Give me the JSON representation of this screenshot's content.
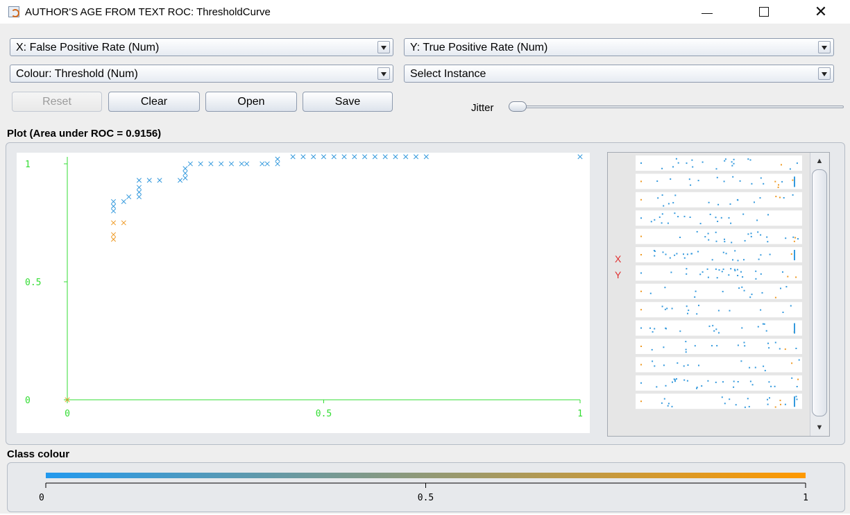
{
  "window": {
    "title": "AUTHOR'S AGE FROM TEXT ROC: ThresholdCurve",
    "controls": {
      "minimize": "—",
      "maximize": "☐",
      "close": "✕"
    }
  },
  "controls": {
    "x_axis_select": "X: False Positive Rate (Num)",
    "y_axis_select": "Y: True Positive Rate (Num)",
    "colour_select": "Colour: Threshold (Num)",
    "instance_select": "Select Instance",
    "buttons": {
      "reset": "Reset",
      "clear": "Clear",
      "open": "Open",
      "save": "Save"
    },
    "jitter_label": "Jitter",
    "jitter_value": 0
  },
  "plot": {
    "title": "Plot (Area under ROC = 0.9156)",
    "axis_color": "#33dd33",
    "marker": "x"
  },
  "chart_data": {
    "type": "scatter",
    "title": "Plot (Area under ROC = 0.9156)",
    "xlabel": "",
    "ylabel": "",
    "xlim": [
      0,
      1
    ],
    "ylim": [
      0,
      1
    ],
    "x_ticks": [
      "0",
      "0.5",
      "1"
    ],
    "y_ticks": [
      "0",
      "0.5",
      "1"
    ],
    "grid": false,
    "series": [
      {
        "color": "#3399dd",
        "points": [
          [
            0.09,
            0.8
          ],
          [
            0.09,
            0.82
          ],
          [
            0.09,
            0.84
          ],
          [
            0.11,
            0.84
          ],
          [
            0.12,
            0.86
          ],
          [
            0.14,
            0.86
          ],
          [
            0.14,
            0.88
          ],
          [
            0.14,
            0.9
          ],
          [
            0.14,
            0.93
          ],
          [
            0.16,
            0.93
          ],
          [
            0.18,
            0.93
          ],
          [
            0.22,
            0.93
          ],
          [
            0.23,
            0.94
          ],
          [
            0.23,
            0.96
          ],
          [
            0.23,
            0.98
          ],
          [
            0.24,
            1.0
          ],
          [
            0.26,
            1.0
          ],
          [
            0.28,
            1.0
          ],
          [
            0.3,
            1.0
          ],
          [
            0.32,
            1.0
          ],
          [
            0.34,
            1.0
          ],
          [
            0.35,
            1.0
          ],
          [
            0.38,
            1.0
          ],
          [
            0.39,
            1.0
          ],
          [
            0.41,
            1.0
          ],
          [
            0.41,
            1.02
          ],
          [
            0.44,
            1.03
          ],
          [
            0.46,
            1.03
          ],
          [
            0.48,
            1.03
          ],
          [
            0.5,
            1.03
          ],
          [
            0.52,
            1.03
          ],
          [
            0.54,
            1.03
          ],
          [
            0.56,
            1.03
          ],
          [
            0.58,
            1.03
          ],
          [
            0.6,
            1.03
          ],
          [
            0.62,
            1.03
          ],
          [
            0.64,
            1.03
          ],
          [
            0.66,
            1.03
          ],
          [
            0.68,
            1.03
          ],
          [
            0.7,
            1.03
          ],
          [
            1.0,
            1.03
          ]
        ]
      },
      {
        "color": "#ee9922",
        "points": [
          [
            0.09,
            0.68
          ],
          [
            0.09,
            0.7
          ],
          [
            0.09,
            0.75
          ],
          [
            0.11,
            0.75
          ],
          [
            0.0,
            0.0
          ]
        ]
      }
    ]
  },
  "matrix": {
    "x_marker": "X",
    "y_marker": "Y",
    "row_count": 14,
    "scroll_up": "▲",
    "scroll_down": "▼"
  },
  "class_colour": {
    "label": "Class colour",
    "tick_labels": [
      "0",
      "0.5",
      "1"
    ],
    "gradient_start": "#2299ee",
    "gradient_end": "#ff9900"
  }
}
